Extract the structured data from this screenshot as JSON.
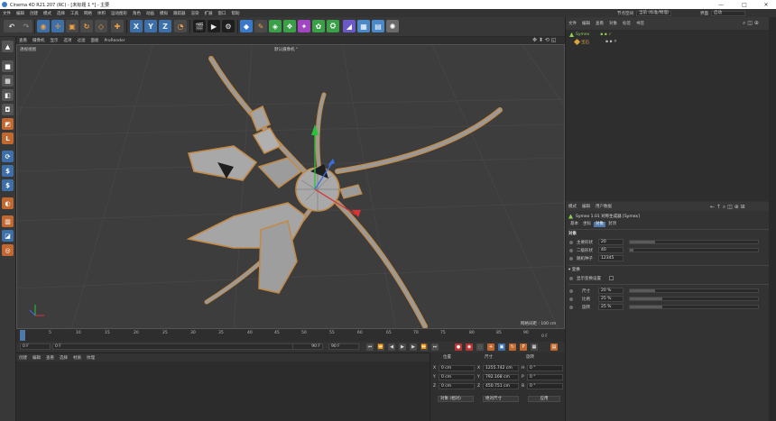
{
  "window": {
    "title": "Cinema 4D R21.207 (RC) - [未标题 1 *] - 主要",
    "minimize": "—",
    "maximize": "□",
    "close": "✕"
  },
  "menubar": {
    "items": [
      "文件",
      "编辑",
      "创建",
      "模式",
      "选择",
      "工具",
      "网格",
      "体积",
      "运动图形",
      "角色",
      "动画",
      "模拟",
      "跟踪器",
      "渲染",
      "扩展",
      "窗口",
      "帮助"
    ],
    "node_space_label": "节点空间",
    "node_space_value": "当前 (标准/物理)",
    "layout_label": "界面",
    "layout_value": "启动"
  },
  "toolbar": {
    "icons": [
      "undo-icon",
      "redo-icon",
      "live-select-icon",
      "move-icon",
      "scale-icon",
      "rotate-icon",
      "recent-tools-icon",
      "x-axis-icon",
      "y-axis-icon",
      "z-axis-icon",
      "world-coords-icon",
      "render-view-icon",
      "render-picture-queue-icon",
      "render-settings-icon",
      "cube-icon",
      "spline-pen-icon",
      "subdivision-icon",
      "cloner-icon",
      "deformer-icon",
      "field-icon",
      "scene-icon",
      "camera-icon",
      "floor-icon",
      "light-icon"
    ],
    "axis_labels": [
      "X",
      "Y",
      "Z"
    ]
  },
  "viewport": {
    "menu": [
      "查看",
      "摄像机",
      "显示",
      "选项",
      "过滤",
      "面板",
      "ProRender"
    ],
    "view_name": "透视视图",
    "camera_label": "默认摄像机 °",
    "grid_spacing": "网格间距 : 100 cm"
  },
  "timeline": {
    "ticks": [
      "0",
      "5",
      "10",
      "15",
      "20",
      "25",
      "30",
      "35",
      "40",
      "45",
      "50",
      "55",
      "60",
      "65",
      "70",
      "75",
      "80",
      "85",
      "90"
    ],
    "end_label": "0 F"
  },
  "playback": {
    "current_frame": "0 F",
    "start_frame": "0 F",
    "end_frame": "90 F",
    "max_frame": "90 F"
  },
  "materials": {
    "menu": [
      "创建",
      "编辑",
      "查看",
      "选择",
      "材质",
      "纹理"
    ]
  },
  "coordinates": {
    "headers": [
      "位置",
      "尺寸",
      "旋转"
    ],
    "rows": [
      {
        "axis": "X",
        "pos": "0 cm",
        "size_axis": "X",
        "size": "1255.742 cm",
        "rot_axis": "H",
        "rot": "0 °"
      },
      {
        "axis": "Y",
        "pos": "0 cm",
        "size_axis": "Y",
        "size": "792.168 cm",
        "rot_axis": "P",
        "rot": "0 °"
      },
      {
        "axis": "Z",
        "pos": "0 cm",
        "size_axis": "Z",
        "size": "450.751 cm",
        "rot_axis": "B",
        "rot": "0 °"
      }
    ],
    "mode_dropdown": "对象 (相对)",
    "size_dropdown": "绝对尺寸",
    "apply_button": "应用"
  },
  "objects": {
    "menu": [
      "文件",
      "编辑",
      "查看",
      "对象",
      "标签",
      "书签"
    ],
    "items": [
      {
        "name": "Symex",
        "color": "#8fd14f"
      },
      {
        "name": "宝石",
        "color": "#e0a23c"
      }
    ]
  },
  "attributes": {
    "menu": [
      "模式",
      "编辑",
      "用户数据"
    ],
    "title": "Symex 1.01 对称生成器 [Symex]",
    "tabs": [
      "基本",
      "坐标",
      "对象",
      "封顶"
    ],
    "active_tab": "对象",
    "section_object": "对象",
    "params": [
      {
        "label": "主要形状",
        "value": "20",
        "fill": 0.2
      },
      {
        "label": "二级形状",
        "value": "40",
        "fill": 0.03
      },
      {
        "label": "随机种子",
        "value": "12345",
        "fill": 0
      }
    ],
    "section_transform": "▾ 变换",
    "show_transform_label": "显示变换设置",
    "transform": [
      {
        "label": "尺寸",
        "value": "20 %",
        "fill": 0.2
      },
      {
        "label": "比例",
        "value": "25 %",
        "fill": 0.25
      },
      {
        "label": "旋转",
        "value": "25 %",
        "fill": 0.25
      }
    ]
  }
}
